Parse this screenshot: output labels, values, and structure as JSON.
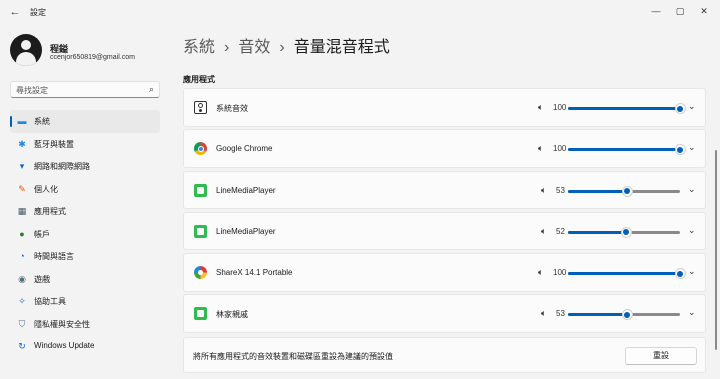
{
  "window": {
    "title": "設定",
    "back_icon": "←",
    "minimize_icon": "—",
    "maximize_icon": "▢",
    "close_icon": "✕"
  },
  "profile": {
    "name": "程鎰",
    "email": "ccenjor650819@gmail.com"
  },
  "search": {
    "placeholder": "尋找設定",
    "icon": "⌕"
  },
  "sidebar": {
    "items": [
      {
        "label": "系統",
        "icon": "▬",
        "color": "#1e88e5"
      },
      {
        "label": "藍牙與裝置",
        "icon": "✱",
        "color": "#1e88e5"
      },
      {
        "label": "網路和網際網路",
        "icon": "▾",
        "color": "#1565c0"
      },
      {
        "label": "個人化",
        "icon": "✎",
        "color": "#e65100"
      },
      {
        "label": "應用程式",
        "icon": "▦",
        "color": "#455a64"
      },
      {
        "label": "帳戶",
        "icon": "●",
        "color": "#2e7d32"
      },
      {
        "label": "時間與語言",
        "icon": "◔",
        "color": "#1565c0"
      },
      {
        "label": "遊戲",
        "icon": "◉",
        "color": "#546e7a"
      },
      {
        "label": "協助工具",
        "icon": "✧",
        "color": "#1565c0"
      },
      {
        "label": "隱私權與安全性",
        "icon": "⛉",
        "color": "#546e7a"
      },
      {
        "label": "Windows Update",
        "icon": "↻",
        "color": "#1565c0"
      }
    ]
  },
  "breadcrumb": {
    "level1": "系統",
    "level2": "音效",
    "level3": "音量混音程式",
    "separator": "›"
  },
  "apps_section": {
    "title": "應用程式",
    "apps": [
      {
        "name": "系統音效",
        "icon": "speaker-icon",
        "volume": "100",
        "fraction": 1.0
      },
      {
        "name": "Google Chrome",
        "icon": "chrome-icon",
        "volume": "100",
        "fraction": 1.0
      },
      {
        "name": "LineMediaPlayer",
        "icon": "line-icon",
        "volume": "53",
        "fraction": 0.53
      },
      {
        "name": "LineMediaPlayer",
        "icon": "line-icon",
        "volume": "52",
        "fraction": 0.52
      },
      {
        "name": "ShareX 14.1 Portable",
        "icon": "sharex-icon",
        "volume": "100",
        "fraction": 1.0
      },
      {
        "name": "林家親戚",
        "icon": "line-icon",
        "volume": "53",
        "fraction": 0.53
      }
    ],
    "volume_icon": "🔈︎",
    "chevron_icon": "⌄"
  },
  "reset": {
    "text": "將所有應用程式的音效裝置和磁碟區重設為建議的預設值",
    "button_label": "重設"
  },
  "colors": {
    "accent": "#005fb8",
    "background": "#f3f3f3",
    "card": "#fbfbfb"
  }
}
